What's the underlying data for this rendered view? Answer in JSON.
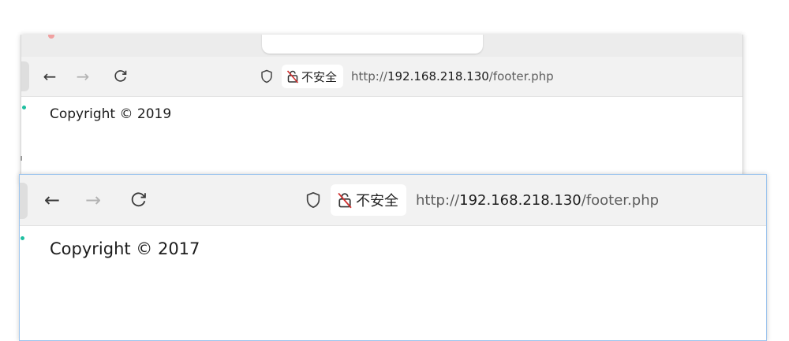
{
  "back_window": {
    "nav": {
      "back_label": "←",
      "forward_label": "→",
      "reload_label": "C"
    },
    "security_label": "不安全",
    "url": {
      "scheme": "http://",
      "host": "192.168.218.130",
      "path": "/footer.php"
    },
    "page_text": "Copyright © 2019"
  },
  "front_window": {
    "nav": {
      "back_label": "←",
      "forward_label": "→",
      "reload_label": "C"
    },
    "security_label": "不安全",
    "url": {
      "scheme": "http://",
      "host": "192.168.218.130",
      "path": "/footer.php"
    },
    "page_text": "Copyright © 2017"
  },
  "icons": {
    "shield": "shield-icon",
    "insecure_lock": "insecure-lock-icon"
  },
  "colors": {
    "accent_border": "#9cc4ee",
    "indicator_dot": "#1fbfa0",
    "toolbar_bg": "#f2f2f2"
  }
}
